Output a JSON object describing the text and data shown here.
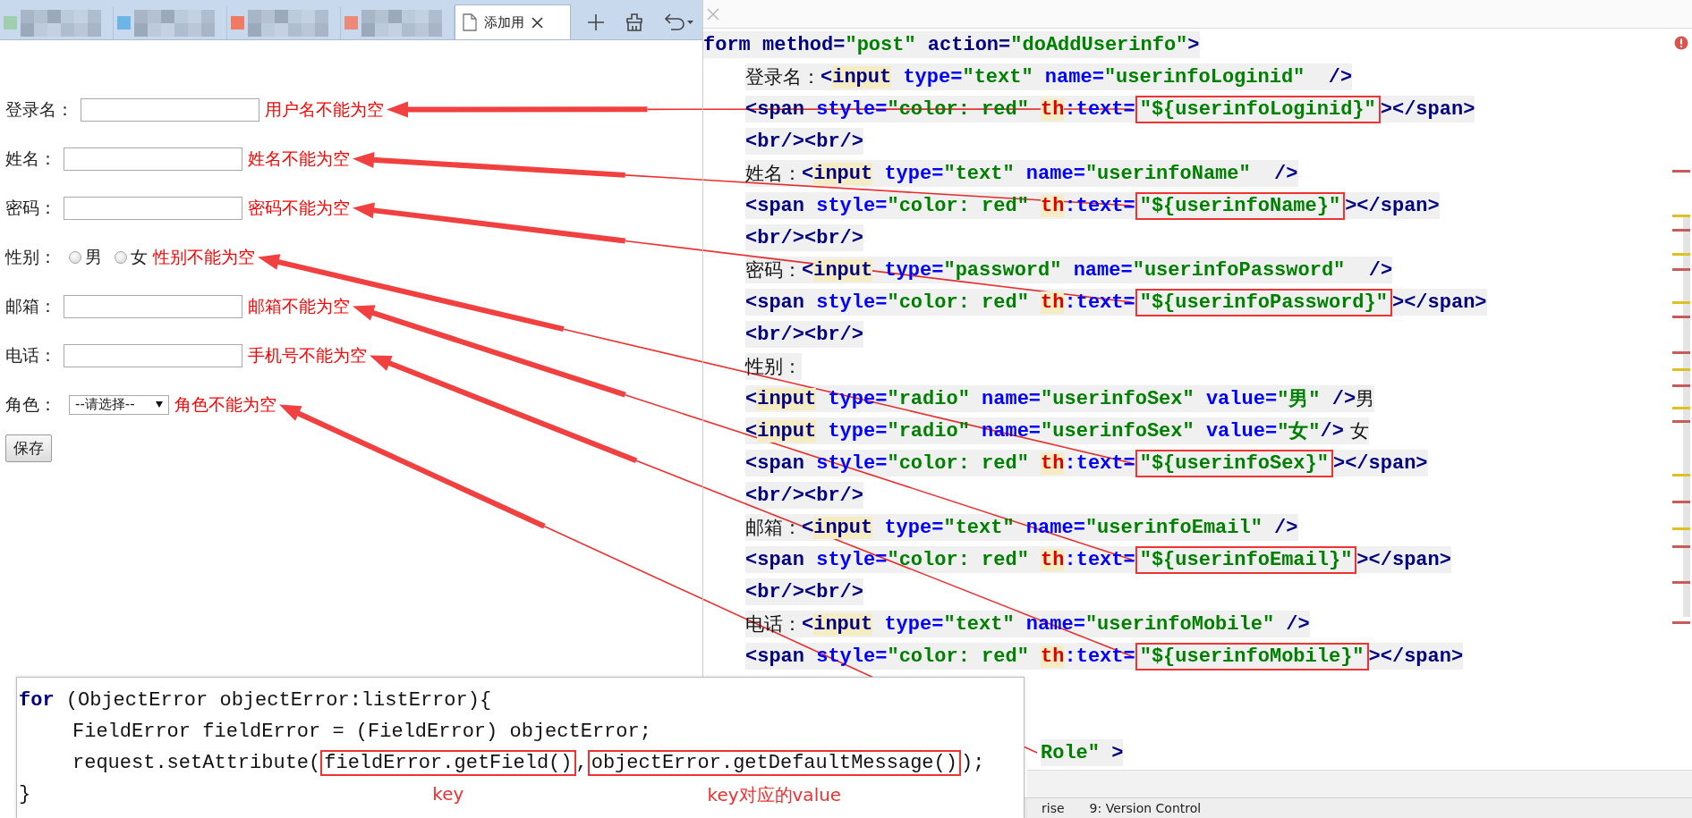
{
  "browser": {
    "tabs": [
      {
        "kind": "blurred",
        "color": "#9fcfae",
        "selected": false
      },
      {
        "kind": "blurred",
        "color": "#6cb5e6",
        "selected": false
      },
      {
        "kind": "blurred",
        "color": "#f07a64",
        "selected": false
      },
      {
        "kind": "blurred",
        "color": "#ec8a7a",
        "selected": false
      },
      {
        "kind": "page",
        "label": "添加用",
        "selected": true
      }
    ]
  },
  "form": {
    "fields": [
      {
        "kind": "text",
        "label": "登录名：",
        "error": "用户名不能为空"
      },
      {
        "kind": "text",
        "label": "姓名：",
        "error": "姓名不能为空"
      },
      {
        "kind": "text",
        "label": "密码：",
        "error": "密码不能为空"
      },
      {
        "kind": "radio",
        "label": "性别：",
        "options": [
          {
            "label": "男",
            "selected": false
          },
          {
            "label": "女",
            "selected": false
          }
        ],
        "error": "性别不能为空"
      },
      {
        "kind": "text",
        "label": "邮箱：",
        "error": "邮箱不能为空"
      },
      {
        "kind": "text",
        "label": "电话：",
        "error": "手机号不能为空"
      },
      {
        "kind": "select",
        "label": "角色：",
        "value": "--请选择--",
        "error": "角色不能为空"
      }
    ],
    "button": "保存"
  },
  "editor": {
    "lines": [
      {
        "segments": [
          {
            "kind": "tag",
            "text": "form method="
          },
          {
            "kind": "str",
            "text": "\"post\""
          },
          {
            "kind": "tag",
            "text": " action="
          },
          {
            "kind": "str",
            "text": "\"doAddUserinfo\""
          },
          {
            "kind": "tag",
            "text": ">"
          }
        ],
        "children": [
          {
            "segments": [
              {
                "kind": "cn",
                "text": "登录名："
              },
              {
                "kind": "tag",
                "text": "<"
              },
              {
                "kind": "hl",
                "text": "input"
              },
              {
                "kind": "attr",
                "text": " type="
              },
              {
                "kind": "str",
                "text": "\"text\""
              },
              {
                "kind": "attr",
                "text": " name="
              },
              {
                "kind": "str",
                "text": "\"userinfoLoginid\""
              },
              {
                "kind": "tag",
                "text": "  />"
              }
            ]
          },
          {
            "segments": [
              {
                "kind": "tag",
                "text": "<span"
              },
              {
                "kind": "attr",
                "text": " style="
              },
              {
                "kind": "str",
                "text": "\"color: red\" "
              },
              {
                "kind": "th",
                "text": "th"
              },
              {
                "kind": "attr",
                "text": ":text="
              },
              {
                "kind": "str",
                "text": "\"${userinfoLoginid}\"",
                "boxed": true
              },
              {
                "kind": "tag",
                "text": "></span>"
              }
            ]
          },
          {
            "segments": [
              {
                "kind": "tag",
                "text": "<br/><br/>"
              }
            ]
          },
          {
            "segments": [
              {
                "kind": "cn",
                "text": "姓名："
              },
              {
                "kind": "tag",
                "text": "<"
              },
              {
                "kind": "hl",
                "text": "input"
              },
              {
                "kind": "attr",
                "text": " type="
              },
              {
                "kind": "str",
                "text": "\"text\""
              },
              {
                "kind": "attr",
                "text": " name="
              },
              {
                "kind": "str",
                "text": "\"userinfoName\""
              },
              {
                "kind": "tag",
                "text": "  />"
              }
            ]
          },
          {
            "segments": [
              {
                "kind": "tag",
                "text": "<span"
              },
              {
                "kind": "attr",
                "text": " style="
              },
              {
                "kind": "str",
                "text": "\"color: red\" "
              },
              {
                "kind": "th",
                "text": "th"
              },
              {
                "kind": "attr",
                "text": ":text="
              },
              {
                "kind": "str",
                "text": "\"${userinfoName}\"",
                "boxed": true
              },
              {
                "kind": "tag",
                "text": "></span>"
              }
            ]
          },
          {
            "segments": [
              {
                "kind": "tag",
                "text": "<br/><br/>"
              }
            ]
          },
          {
            "segments": [
              {
                "kind": "cn",
                "text": "密码："
              },
              {
                "kind": "tag",
                "text": "<"
              },
              {
                "kind": "hl",
                "text": "input"
              },
              {
                "kind": "attr",
                "text": " type="
              },
              {
                "kind": "str",
                "text": "\"password\""
              },
              {
                "kind": "attr",
                "text": " name="
              },
              {
                "kind": "str",
                "text": "\"userinfoPassword\""
              },
              {
                "kind": "tag",
                "text": "  />"
              }
            ]
          },
          {
            "segments": [
              {
                "kind": "tag",
                "text": "<span"
              },
              {
                "kind": "attr",
                "text": " style="
              },
              {
                "kind": "str",
                "text": "\"color: red\" "
              },
              {
                "kind": "th",
                "text": "th"
              },
              {
                "kind": "attr",
                "text": ":text="
              },
              {
                "kind": "str",
                "text": "\"${userinfoPassword}\"",
                "boxed": true
              },
              {
                "kind": "tag",
                "text": "></span>"
              }
            ]
          },
          {
            "segments": [
              {
                "kind": "tag",
                "text": "<br/><br/>"
              }
            ]
          },
          {
            "segments": [
              {
                "kind": "cn",
                "text": "性别："
              }
            ]
          },
          {
            "segments": [
              {
                "kind": "tag",
                "text": "<"
              },
              {
                "kind": "hl",
                "text": "input"
              },
              {
                "kind": "attr",
                "text": " type="
              },
              {
                "kind": "str",
                "text": "\"radio\""
              },
              {
                "kind": "attr",
                "text": " name="
              },
              {
                "kind": "str",
                "text": "\"userinfoSex\""
              },
              {
                "kind": "attr",
                "text": " value="
              },
              {
                "kind": "str",
                "text": "\"男\""
              },
              {
                "kind": "tag",
                "text": " />"
              },
              {
                "kind": "cn",
                "text": "男"
              }
            ]
          },
          {
            "segments": [
              {
                "kind": "tag",
                "text": "<"
              },
              {
                "kind": "hl",
                "text": "input"
              },
              {
                "kind": "attr",
                "text": " type="
              },
              {
                "kind": "str",
                "text": "\"radio\""
              },
              {
                "kind": "attr",
                "text": " name="
              },
              {
                "kind": "str",
                "text": "\"userinfoSex\""
              },
              {
                "kind": "attr",
                "text": " value="
              },
              {
                "kind": "str",
                "text": "\"女\""
              },
              {
                "kind": "tag",
                "text": "/>"
              },
              {
                "kind": "cn",
                "text": " 女"
              }
            ]
          },
          {
            "segments": [
              {
                "kind": "tag",
                "text": "<span"
              },
              {
                "kind": "attr",
                "text": " style="
              },
              {
                "kind": "str",
                "text": "\"color: red\" "
              },
              {
                "kind": "th",
                "text": "th"
              },
              {
                "kind": "attr",
                "text": ":text="
              },
              {
                "kind": "str",
                "text": "\"${userinfoSex}\"",
                "boxed": true
              },
              {
                "kind": "tag",
                "text": "></span>"
              }
            ]
          },
          {
            "segments": [
              {
                "kind": "tag",
                "text": "<br/><br/>"
              }
            ]
          },
          {
            "segments": [
              {
                "kind": "cn",
                "text": "邮箱："
              },
              {
                "kind": "tag",
                "text": "<"
              },
              {
                "kind": "hl",
                "text": "input"
              },
              {
                "kind": "attr",
                "text": " type="
              },
              {
                "kind": "str",
                "text": "\"text\""
              },
              {
                "kind": "attr",
                "text": " name="
              },
              {
                "kind": "str",
                "text": "\"userinfoEmail\""
              },
              {
                "kind": "tag",
                "text": " />"
              }
            ]
          },
          {
            "segments": [
              {
                "kind": "tag",
                "text": "<span"
              },
              {
                "kind": "attr",
                "text": " style="
              },
              {
                "kind": "str",
                "text": "\"color: red\" "
              },
              {
                "kind": "th",
                "text": "th"
              },
              {
                "kind": "attr",
                "text": ":text="
              },
              {
                "kind": "str",
                "text": "\"${userinfoEmail}\"",
                "boxed": true
              },
              {
                "kind": "tag",
                "text": "></span>"
              }
            ]
          },
          {
            "segments": [
              {
                "kind": "tag",
                "text": "<br/><br/>"
              }
            ]
          },
          {
            "segments": [
              {
                "kind": "cn",
                "text": "电话："
              },
              {
                "kind": "tag",
                "text": "<"
              },
              {
                "kind": "hl",
                "text": "input"
              },
              {
                "kind": "attr",
                "text": " type="
              },
              {
                "kind": "str",
                "text": "\"text\""
              },
              {
                "kind": "attr",
                "text": " name="
              },
              {
                "kind": "str",
                "text": "\"userinfoMobile\""
              },
              {
                "kind": "tag",
                "text": " />"
              }
            ]
          },
          {
            "segments": [
              {
                "kind": "tag",
                "text": "<span"
              },
              {
                "kind": "attr",
                "text": " style="
              },
              {
                "kind": "str",
                "text": "\"color: red\" "
              },
              {
                "kind": "th",
                "text": "th"
              },
              {
                "kind": "attr",
                "text": ":text="
              },
              {
                "kind": "str",
                "text": "\"${userinfoMobile}\"",
                "boxed": true
              },
              {
                "kind": "tag",
                "text": "></span>"
              }
            ]
          },
          {
            "kind": "tail",
            "segments": [
              {
                "kind": "str",
                "text": "Role\""
              },
              {
                "kind": "tag",
                "text": " >"
              }
            ]
          }
        ]
      }
    ]
  },
  "status_bar": {
    "items": [
      "rise",
      "9: Version Control"
    ]
  },
  "snippet": {
    "lines": [
      {
        "segments": [
          {
            "kind": "kw",
            "text": "for"
          },
          {
            "kind": "code",
            "text": " (ObjectError objectError:listError){"
          }
        ],
        "children": [
          {
            "segments": [
              {
                "kind": "code",
                "text": "FieldError fieldError = (FieldError) objectError;"
              }
            ]
          },
          {
            "segments": [
              {
                "kind": "code",
                "text": "request.setAttribute("
              },
              {
                "kind": "code",
                "text": "fieldError.getField()",
                "boxed": true,
                "note": "key"
              },
              {
                "kind": "code",
                "text": ","
              },
              {
                "kind": "code",
                "text": "objectError.getDefaultMessage()",
                "boxed": true,
                "note": "key对应的value"
              },
              {
                "kind": "code",
                "text": ");"
              }
            ]
          }
        ]
      },
      {
        "segments": [
          {
            "kind": "code",
            "text": "}"
          }
        ]
      }
    ]
  }
}
